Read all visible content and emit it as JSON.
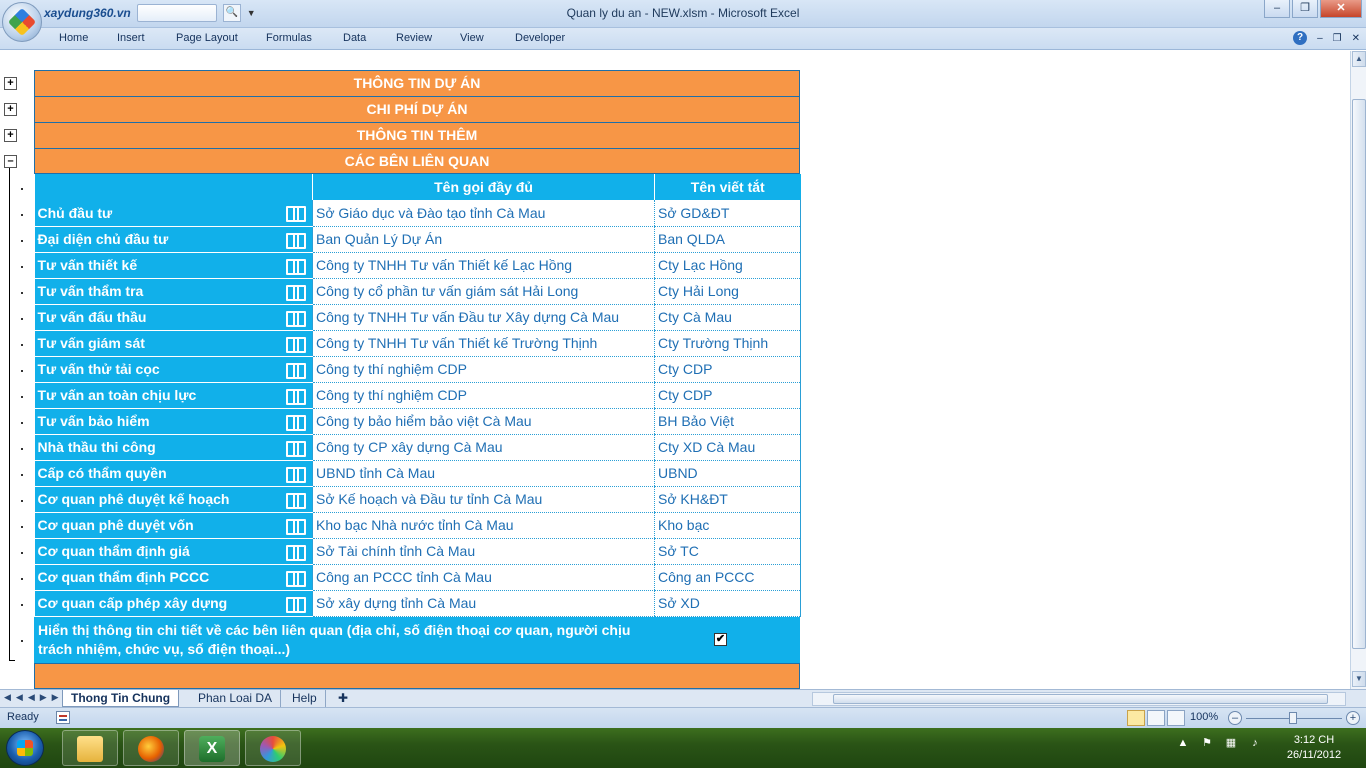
{
  "window": {
    "title": "Quan ly du an - NEW.xlsm - Microsoft Excel",
    "qat_site": "xaydung360.vn"
  },
  "ribbon": {
    "tabs": [
      "Home",
      "Insert",
      "Page Layout",
      "Formulas",
      "Data",
      "Review",
      "View",
      "Developer"
    ]
  },
  "sheet": {
    "sections": [
      "THÔNG TIN DỰ ÁN",
      "CHI PHÍ DỰ ÁN",
      "THÔNG TIN THÊM",
      "CÁC BÊN LIÊN QUAN"
    ],
    "table": {
      "headers": [
        "",
        "Tên gọi đầy đủ",
        "Tên viết tắt"
      ],
      "rows": [
        {
          "role": "Chủ đầu tư",
          "full": "Sở Giáo dục và Đào tạo tỉnh Cà Mau",
          "abbr": "Sở GD&ĐT"
        },
        {
          "role": "Đại diện chủ đầu tư",
          "full": "Ban Quản Lý Dự Án",
          "abbr": "Ban QLDA"
        },
        {
          "role": "Tư vấn thiết kế",
          "full": "Công ty TNHH Tư vấn Thiết kế Lạc Hồng",
          "abbr": "Cty Lạc Hồng"
        },
        {
          "role": "Tư vấn thẩm tra",
          "full": "Công ty cổ phần tư vấn giám sát Hải Long",
          "abbr": "Cty Hải Long"
        },
        {
          "role": "Tư vấn đấu thầu",
          "full": "Công ty TNHH Tư vấn Đầu tư Xây dựng Cà Mau",
          "abbr": "Cty Cà Mau"
        },
        {
          "role": "Tư vấn giám sát",
          "full": "Công ty TNHH Tư vấn Thiết kế Trường Thịnh",
          "abbr": "Cty Trường Thịnh"
        },
        {
          "role": "Tư vấn thử tải cọc",
          "full": "Công ty thí nghiệm CDP",
          "abbr": "Cty CDP"
        },
        {
          "role": "Tư vấn an toàn chịu lực",
          "full": "Công ty thí nghiệm CDP",
          "abbr": "Cty CDP"
        },
        {
          "role": "Tư vấn bảo hiểm",
          "full": "Công ty bảo hiểm bảo việt Cà Mau",
          "abbr": "BH Bảo Việt"
        },
        {
          "role": "Nhà thầu thi công",
          "full": "Công ty CP xây dựng Cà Mau",
          "abbr": "Cty XD Cà Mau"
        },
        {
          "role": "Cấp có thẩm quyền",
          "full": "UBND tỉnh Cà Mau",
          "abbr": "UBND"
        },
        {
          "role": "Cơ quan phê duyệt kế hoạch",
          "full": "Sở Kế hoạch và Đầu tư tỉnh Cà Mau",
          "abbr": "Sở KH&ĐT"
        },
        {
          "role": "Cơ quan phê duyệt vốn",
          "full": "Kho bạc Nhà nước tỉnh Cà Mau",
          "abbr": "Kho bạc"
        },
        {
          "role": "Cơ quan thẩm định giá",
          "full": "Sở Tài chính tỉnh Cà Mau",
          "abbr": "Sở TC"
        },
        {
          "role": "Cơ quan thẩm định PCCC",
          "full": "Công an PCCC tỉnh Cà Mau",
          "abbr": "Công an PCCC"
        },
        {
          "role": "Cơ quan cấp phép xây dựng",
          "full": "Sở xây dựng tỉnh Cà Mau",
          "abbr": "Sở XD"
        }
      ]
    },
    "footer_text": "Hiển thị thông tin chi tiết về các bên liên quan (địa chỉ, số điện thoại cơ quan, người chịu trách nhiệm, chức vụ, số điện thoại...)",
    "footer_checked": true
  },
  "sheet_tabs": [
    "Thong Tin Chung",
    "Phan Loai DA",
    "Help"
  ],
  "status": {
    "ready": "Ready",
    "zoom": "100%"
  },
  "taskbar": {
    "time": "3:12 CH",
    "date": "26/11/2012"
  }
}
